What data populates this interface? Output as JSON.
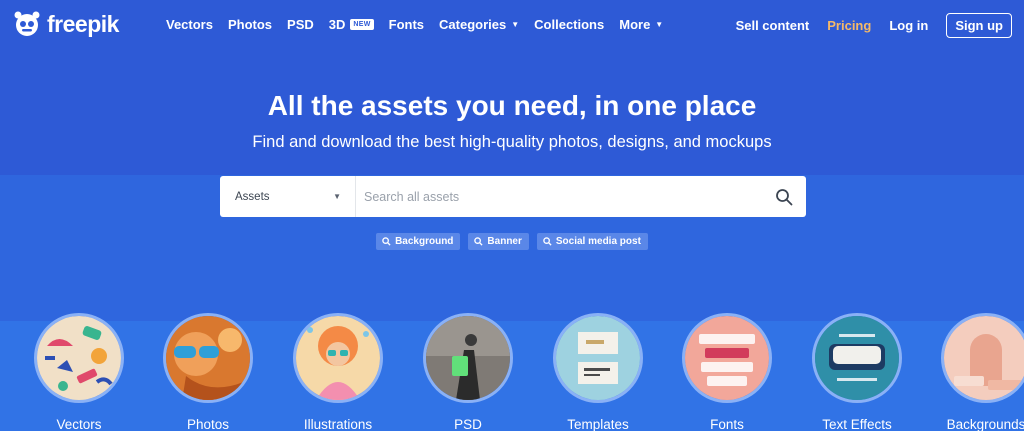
{
  "brand": {
    "name": "freepik"
  },
  "nav": {
    "items": [
      {
        "label": "Vectors"
      },
      {
        "label": "Photos"
      },
      {
        "label": "PSD"
      },
      {
        "label": "3D",
        "badge": "NEW"
      },
      {
        "label": "Fonts"
      },
      {
        "label": "Categories",
        "dropdown": true
      },
      {
        "label": "Collections"
      },
      {
        "label": "More",
        "dropdown": true
      }
    ],
    "sell": "Sell content",
    "pricing": "Pricing",
    "login": "Log in",
    "signup": "Sign up"
  },
  "hero": {
    "title": "All the assets you need, in one place",
    "subtitle": "Find and download the best high-quality photos, designs, and mockups"
  },
  "search": {
    "type": "Assets",
    "placeholder": "Search all assets"
  },
  "suggestions": [
    "Background",
    "Banner",
    "Social media post"
  ],
  "categories": [
    {
      "label": "Vectors"
    },
    {
      "label": "Photos"
    },
    {
      "label": "Illustrations"
    },
    {
      "label": "PSD"
    },
    {
      "label": "Templates"
    },
    {
      "label": "Fonts"
    },
    {
      "label": "Text Effects"
    },
    {
      "label": "Backgrounds"
    }
  ],
  "colors": {
    "nav_bg": "#2e5ad6",
    "accent_pricing": "#f5b968",
    "chip_bg": "#5a87e8",
    "circle_border": "#8ab1f6"
  }
}
